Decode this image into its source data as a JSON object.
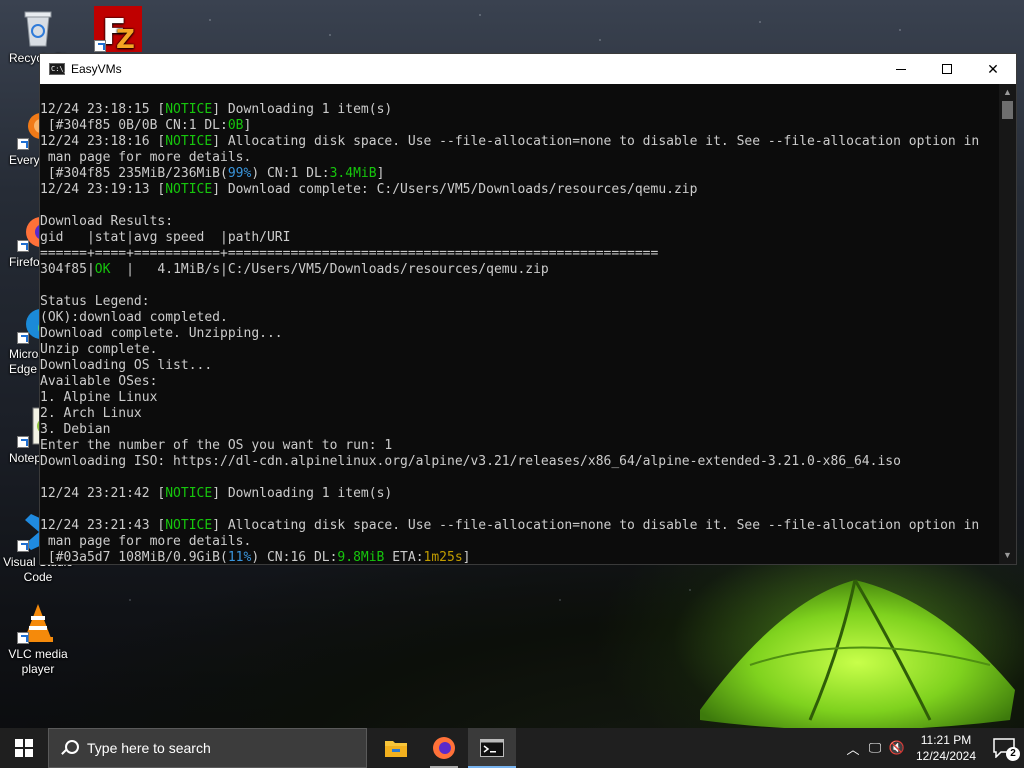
{
  "desktop": {
    "icons": [
      {
        "label": "Recycle Bin"
      },
      {
        "label": "FileZilla"
      },
      {
        "label": "Everything"
      },
      {
        "label": "Firefox"
      },
      {
        "label": "Microsoft Edge"
      },
      {
        "label": "Notepad++"
      },
      {
        "label": "Visual Studio Code"
      },
      {
        "label": "VLC media player"
      }
    ]
  },
  "window": {
    "title": "EasyVMs",
    "icon_text": "C:\\_",
    "controls": {
      "minimize": "minimize-icon",
      "maximize": "maximize-icon",
      "close": "close-icon"
    }
  },
  "console": {
    "lines": [
      [
        {
          "t": "12/24 23:18:15 ["
        },
        {
          "t": "NOTICE",
          "c": "g"
        },
        {
          "t": "] Downloading 1 item(s)"
        }
      ],
      [
        {
          "t": " [#304f85 0B/0B CN:1 DL:"
        },
        {
          "t": "0B",
          "c": "g"
        },
        {
          "t": "]"
        }
      ],
      [
        {
          "t": "12/24 23:18:16 ["
        },
        {
          "t": "NOTICE",
          "c": "g"
        },
        {
          "t": "] Allocating disk space. Use --file-allocation=none to disable it. See --file-allocation option in"
        }
      ],
      [
        {
          "t": " man page for more details."
        }
      ],
      [
        {
          "t": " [#304f85 235MiB/236MiB("
        },
        {
          "t": "99%",
          "c": "c"
        },
        {
          "t": ") CN:1 DL:"
        },
        {
          "t": "3.4MiB",
          "c": "g"
        },
        {
          "t": "]"
        }
      ],
      [
        {
          "t": "12/24 23:19:13 ["
        },
        {
          "t": "NOTICE",
          "c": "g"
        },
        {
          "t": "] Download complete: C:/Users/VM5/Downloads/resources/qemu.zip"
        }
      ],
      [
        {
          "t": ""
        }
      ],
      [
        {
          "t": "Download Results:"
        }
      ],
      [
        {
          "t": "gid   |stat|avg speed  |path/URI"
        }
      ],
      [
        {
          "t": "======+====+===========+======================================================="
        }
      ],
      [
        {
          "t": "304f85|"
        },
        {
          "t": "OK",
          "c": "g"
        },
        {
          "t": "  |   4.1MiB/s|C:/Users/VM5/Downloads/resources/qemu.zip"
        }
      ],
      [
        {
          "t": ""
        }
      ],
      [
        {
          "t": "Status Legend:"
        }
      ],
      [
        {
          "t": "(OK):download completed."
        }
      ],
      [
        {
          "t": "Download complete. Unzipping..."
        }
      ],
      [
        {
          "t": "Unzip complete."
        }
      ],
      [
        {
          "t": "Downloading OS list..."
        }
      ],
      [
        {
          "t": "Available OSes:"
        }
      ],
      [
        {
          "t": "1. Alpine Linux"
        }
      ],
      [
        {
          "t": "2. Arch Linux"
        }
      ],
      [
        {
          "t": "3. Debian"
        }
      ],
      [
        {
          "t": "Enter the number of the OS you want to run: 1"
        }
      ],
      [
        {
          "t": "Downloading ISO: https://dl-cdn.alpinelinux.org/alpine/v3.21/releases/x86_64/alpine-extended-3.21.0-x86_64.iso"
        }
      ],
      [
        {
          "t": ""
        }
      ],
      [
        {
          "t": "12/24 23:21:42 ["
        },
        {
          "t": "NOTICE",
          "c": "g"
        },
        {
          "t": "] Downloading 1 item(s)"
        }
      ],
      [
        {
          "t": ""
        }
      ],
      [
        {
          "t": "12/24 23:21:43 ["
        },
        {
          "t": "NOTICE",
          "c": "g"
        },
        {
          "t": "] Allocating disk space. Use --file-allocation=none to disable it. See --file-allocation option in"
        }
      ],
      [
        {
          "t": " man page for more details."
        }
      ],
      [
        {
          "t": " [#03a5d7 108MiB/0.9GiB("
        },
        {
          "t": "11%",
          "c": "c"
        },
        {
          "t": ") CN:16 DL:"
        },
        {
          "t": "9.8MiB",
          "c": "g"
        },
        {
          "t": " ETA:"
        },
        {
          "t": "1m25s",
          "c": "y"
        },
        {
          "t": "]"
        }
      ]
    ]
  },
  "taskbar": {
    "search_placeholder": "Type here to search",
    "apps": [
      "file-explorer-icon",
      "firefox-icon",
      "terminal-icon"
    ],
    "time": "11:21 PM",
    "date": "12/24/2024",
    "notification_count": "2"
  }
}
